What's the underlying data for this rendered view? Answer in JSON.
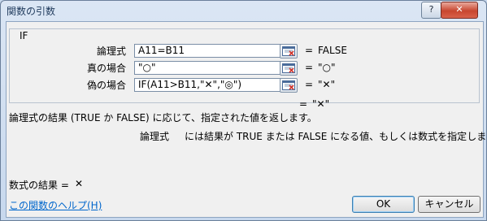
{
  "window": {
    "title": "関数の引数",
    "help_button": "?",
    "close_button": "✕"
  },
  "function": {
    "name": "IF"
  },
  "arguments": [
    {
      "label": "論理式",
      "value": "A11=B11",
      "result": "FALSE"
    },
    {
      "label": "真の場合",
      "value": "\"○\"",
      "result": "\"○\""
    },
    {
      "label": "偽の場合",
      "value": "IF(A11>B11,\"✕\",\"◎\")",
      "result": "\"✕\""
    }
  ],
  "equals_sign": "=",
  "function_result_value": "\"✕\"",
  "description": "論理式の結果 (TRUE か FALSE) に応じて、指定された値を返します。",
  "argument_description": {
    "name": "論理式",
    "text": "には結果が TRUE または FALSE になる値、もしくは数式を指定します。"
  },
  "formula_result": {
    "label": "数式の結果 =",
    "value": "✕"
  },
  "help_link": "この関数のヘルプ(H)",
  "buttons": {
    "ok": "OK",
    "cancel": "キャンセル"
  },
  "icons": {
    "collapse_dialog": "collapse-dialog-icon"
  }
}
